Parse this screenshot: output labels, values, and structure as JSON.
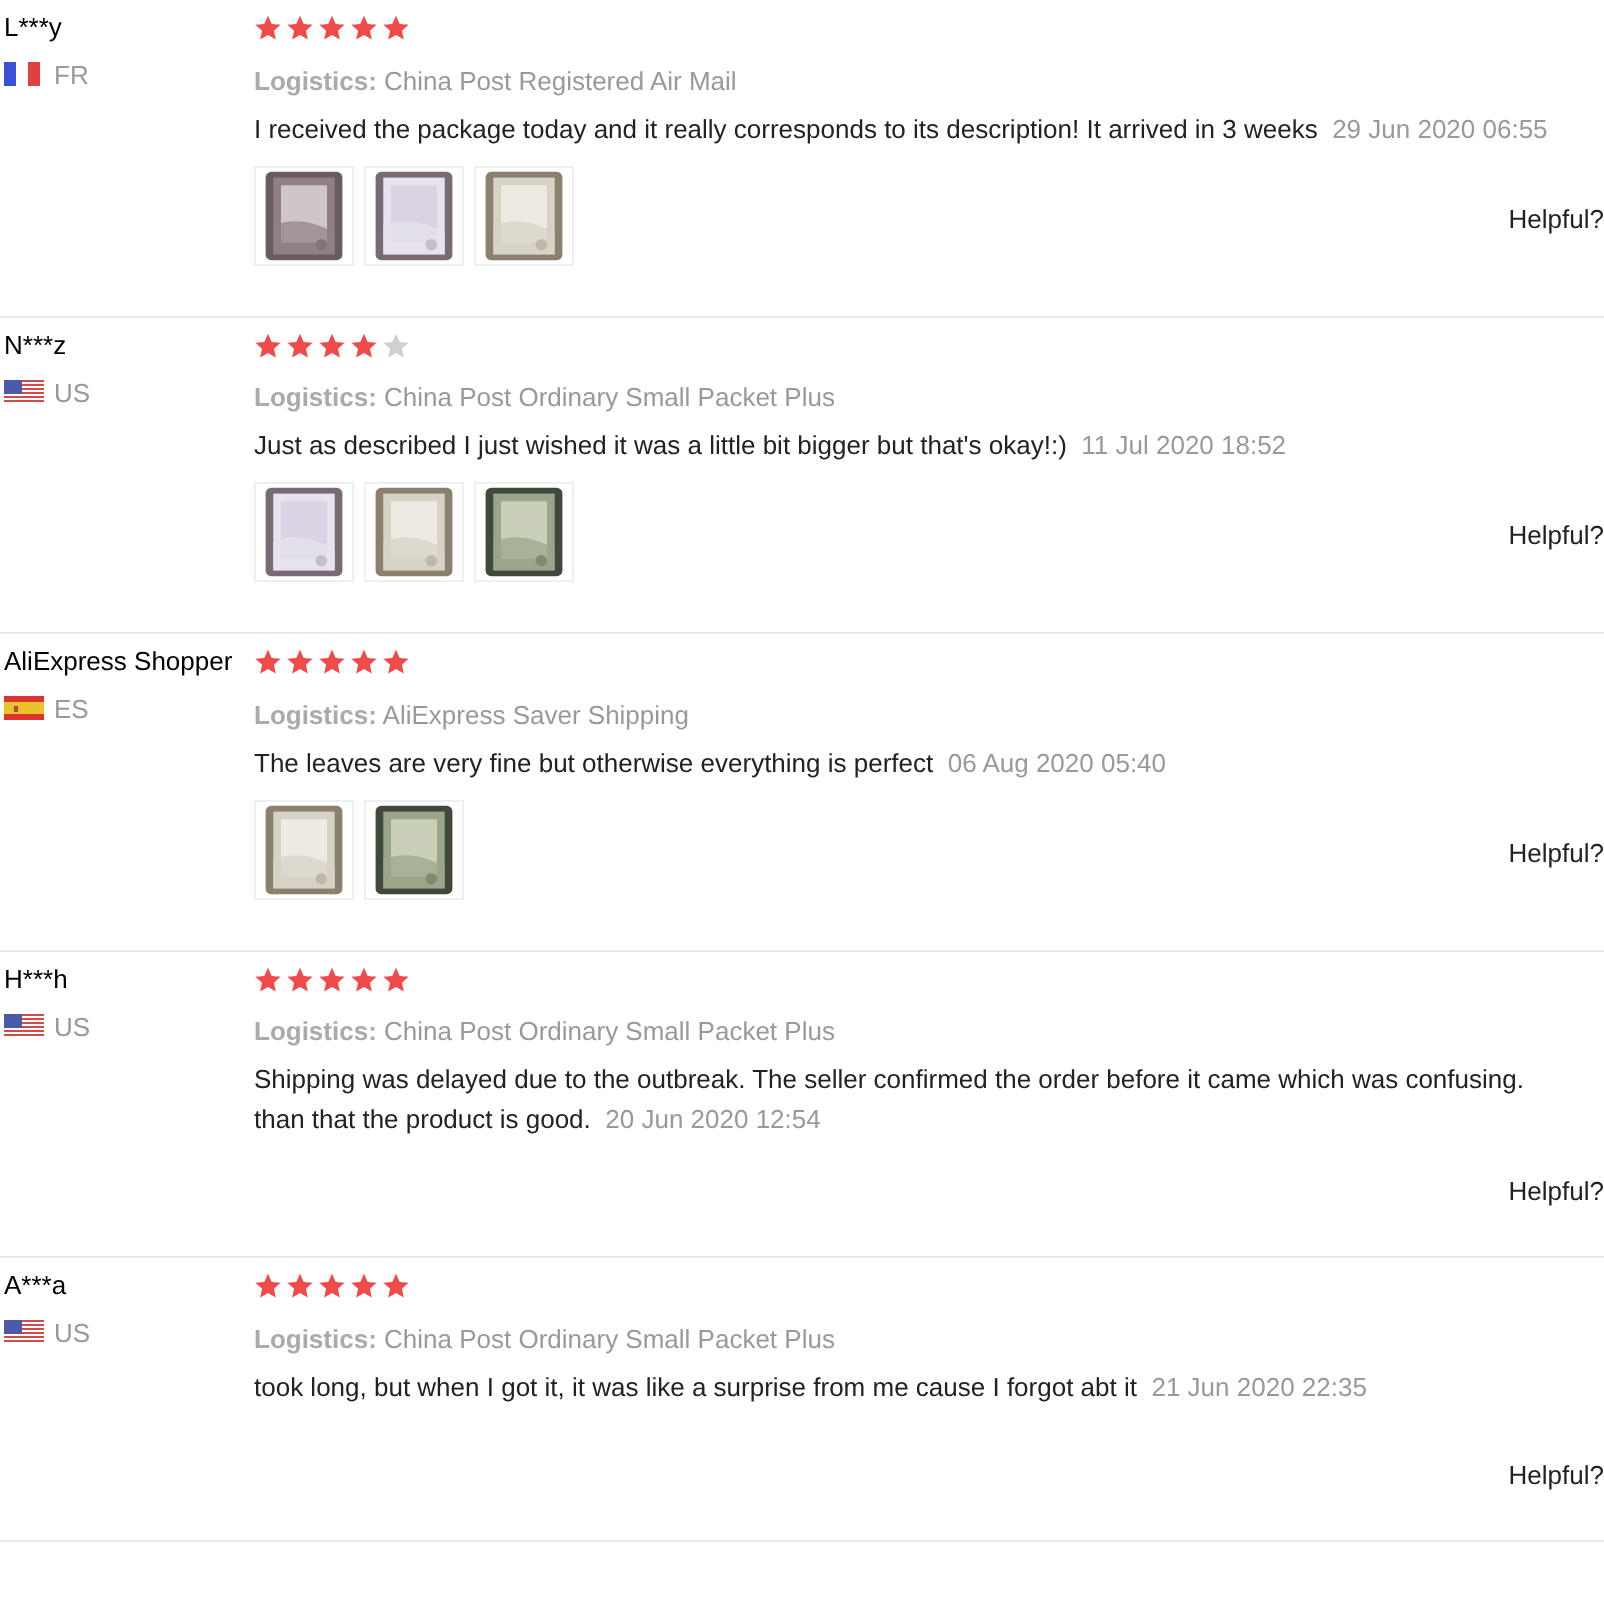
{
  "reviews": [
    {
      "name": "L***y",
      "flag": {
        "kind": "fr"
      },
      "country": "FR",
      "stars": 5,
      "logistics_label": "Logistics:",
      "logistics": "China Post Registered Air Mail",
      "text_lines": [
        "I received the package today and it really corresponds to its description! It arrived in 3 weeks"
      ],
      "date": "29 Jun 2020 06:55",
      "photos": [
        {
          "kind": "picture"
        },
        {
          "kind": "picture"
        },
        {
          "kind": "picture"
        }
      ],
      "helpful": "Helpful?"
    },
    {
      "name": "N***z",
      "flag": {
        "kind": "us"
      },
      "country": "US",
      "stars": 4,
      "logistics_label": "Logistics:",
      "logistics": "China Post Ordinary Small Packet Plus",
      "text_lines": [
        "Just as described I just wished it was a little bit bigger but that's okay!:)"
      ],
      "date": "11 Jul 2020 18:52",
      "photos": [
        {
          "kind": "picture"
        },
        {
          "kind": "picture"
        },
        {
          "kind": "picture"
        }
      ],
      "helpful": "Helpful?"
    },
    {
      "name": "AliExpress Shopper",
      "flag": {
        "kind": "es"
      },
      "country": "ES",
      "stars": 5,
      "logistics_label": "Logistics:",
      "logistics": "AliExpress Saver Shipping",
      "text_lines": [
        "The leaves are very fine but otherwise everything is perfect"
      ],
      "date": "06 Aug 2020 05:40",
      "photos": [
        {
          "kind": "picture"
        },
        {
          "kind": "picture"
        }
      ],
      "helpful": "Helpful?"
    },
    {
      "name": "H***h",
      "flag": {
        "kind": "us"
      },
      "country": "US",
      "stars": 5,
      "logistics_label": "Logistics:",
      "logistics": "China Post Ordinary Small Packet Plus",
      "text_lines": [
        "Shipping was delayed due to the outbreak. The seller confirmed the order before it came which was confusing.",
        "than that the product is good."
      ],
      "date": "20 Jun 2020 12:54",
      "helpful": "Helpful?"
    },
    {
      "name": "A***a",
      "flag": {
        "kind": "us"
      },
      "country": "US",
      "stars": 5,
      "logistics_label": "Logistics:",
      "logistics": "China Post Ordinary Small Packet Plus",
      "text_lines": [
        "took long, but when I got it, it was like a surprise from me cause I forgot abt it"
      ],
      "date": "21 Jun 2020 22:35",
      "helpful": "Helpful?"
    }
  ]
}
